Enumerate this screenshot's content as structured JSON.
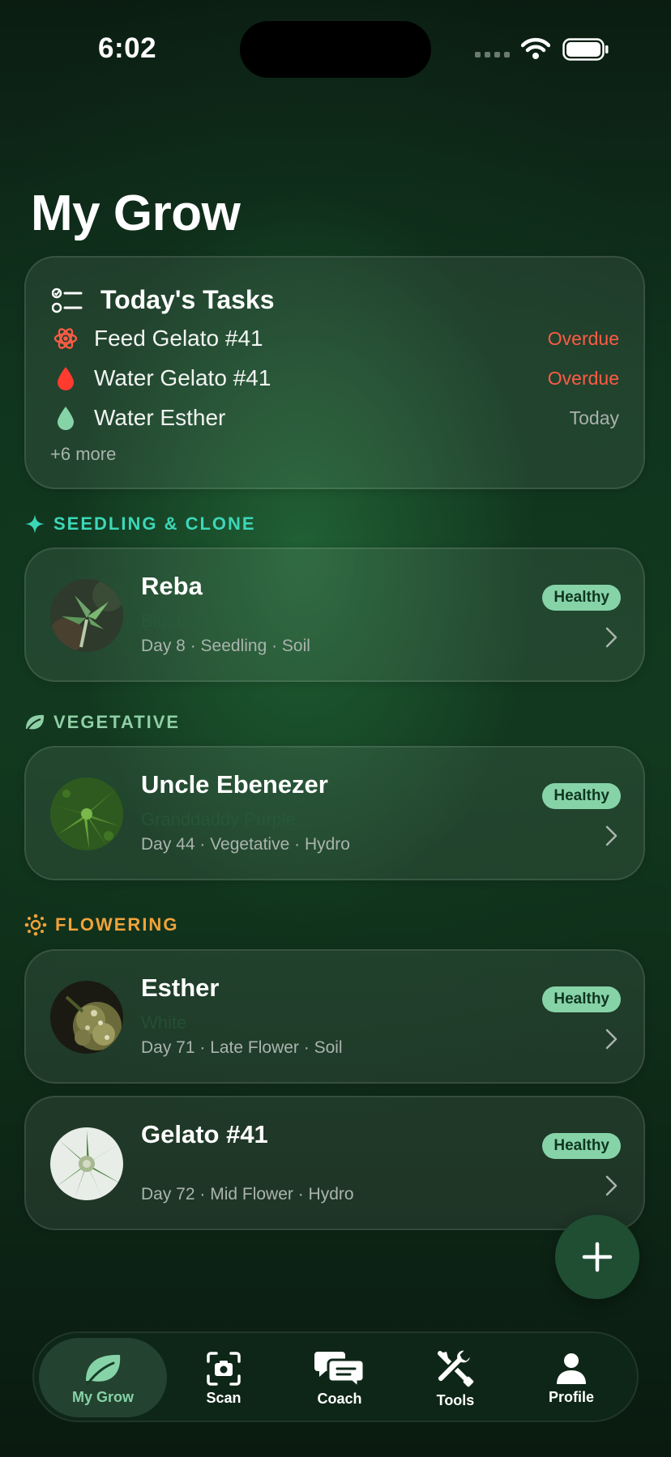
{
  "status_bar": {
    "time": "6:02"
  },
  "page_title": "My Grow",
  "tasks": {
    "title": "Today's Tasks",
    "items": [
      {
        "label": "Feed Gelato #41",
        "status": "Overdue",
        "icon": "nutrient-atom-icon"
      },
      {
        "label": "Water Gelato #41",
        "status": "Overdue",
        "icon": "water-drop-red-icon"
      },
      {
        "label": "Water Esther",
        "status": "Today",
        "icon": "water-drop-green-icon"
      }
    ],
    "more": "+6 more"
  },
  "sections": {
    "seedling": "SEEDLING & CLONE",
    "vegetative": "VEGETATIVE",
    "flowering": "FLOWERING"
  },
  "plants": [
    {
      "name": "Reba",
      "strain": "Blueberry",
      "meta": "Day 8 · Seedling · Soil",
      "status": "Healthy"
    },
    {
      "name": "Uncle Ebenezer",
      "strain": "Granddaddy Purple",
      "meta": "Day 44 · Vegetative · Hydro",
      "status": "Healthy"
    },
    {
      "name": "Esther",
      "strain": "White",
      "meta": "Day 71 · Late Flower · Soil",
      "status": "Healthy"
    },
    {
      "name": "Gelato #41",
      "strain": "",
      "meta": "Day 72 · Mid Flower · Hydro",
      "status": "Healthy"
    }
  ],
  "tabs": [
    {
      "label": "My Grow",
      "icon": "leaf-icon",
      "active": true
    },
    {
      "label": "Scan",
      "icon": "camera-scan-icon"
    },
    {
      "label": "Coach",
      "icon": "chat-bubbles-icon"
    },
    {
      "label": "Tools",
      "icon": "tools-icon"
    },
    {
      "label": "Profile",
      "icon": "person-icon"
    }
  ],
  "colors": {
    "overdue": "#ff5b45",
    "healthy_badge": "#86d3a8",
    "seedling": "#3cd7b8",
    "flowering": "#f0a33b"
  }
}
